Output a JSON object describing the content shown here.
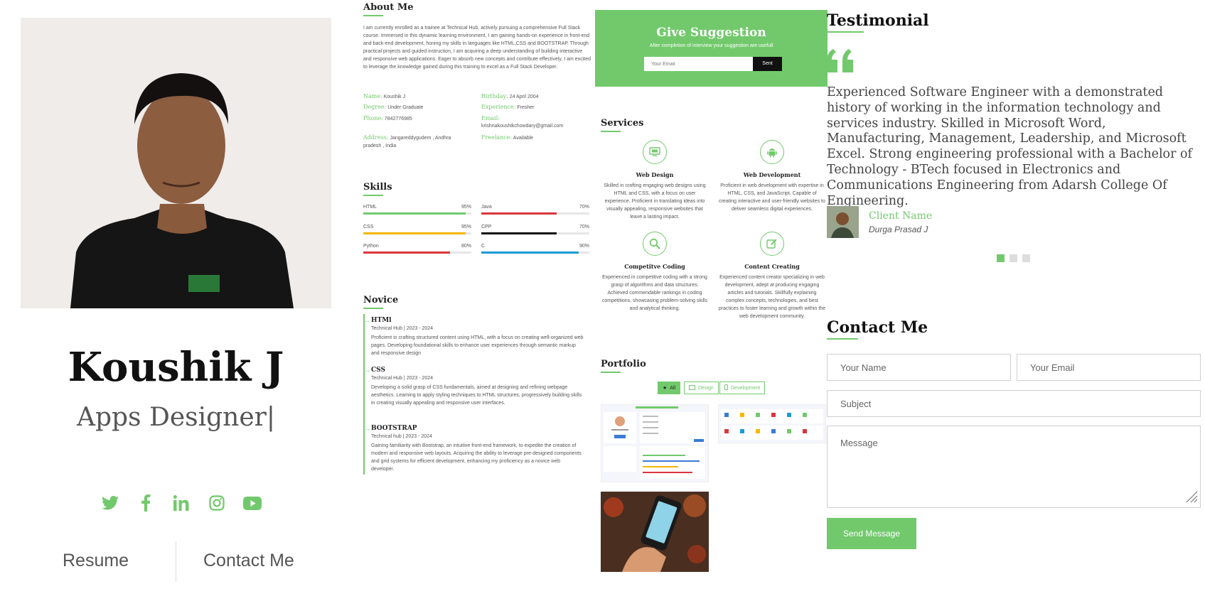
{
  "profile": {
    "name": "Koushik J",
    "role": "Apps Designer|",
    "socials": [
      "twitter-icon",
      "facebook-icon",
      "linkedin-icon",
      "instagram-icon",
      "youtube-icon"
    ],
    "links": {
      "resume": "Resume",
      "contact": "Contact Me"
    }
  },
  "about": {
    "title": "About Me",
    "text": "I am currently enrolled as a trainee at Technical Hub, actively pursuing a comprehensive Full Stack course. Immersed in this dynamic learning environment, I am gaining hands-on experience in front-end and back-end development, honing my skills in languages like HTML,CSS and BOOTSTRAP. Through practical projects and guided instruction, I am acquiring a deep understanding of building interactive and responsive web applications. Eager to absorb new concepts and contribute effectively, I am excited to leverage the knowledge gained during this training to excel as a Full Stack Developer.",
    "fields": {
      "name_label": "Name:",
      "name_value": "Koushik J",
      "birthday_label": "Birthday:",
      "birthday_value": "24 April 2004",
      "degree_label": "Degree:",
      "degree_value": "Under Graduate",
      "experience_label": "Experience:",
      "experience_value": "Fresher",
      "phone_label": "Phone:",
      "phone_value": "7842776985",
      "email_label": "Email:",
      "email_value": "krishnakoushikchowdary@gmail.com",
      "address_label": "Address:",
      "address_value": "Jangareddygudem , Andhra pradesh , India",
      "freelance_label": "Freelance:",
      "freelance_value": "Available"
    }
  },
  "skills": {
    "title": "Skills",
    "items": [
      {
        "name": "HTML",
        "percent": "95%",
        "value": 95,
        "color": "#72c96c"
      },
      {
        "name": "Java",
        "percent": "70%",
        "value": 70,
        "color": "#d9363e"
      },
      {
        "name": "CSS",
        "percent": "95%",
        "value": 95,
        "color": "#f5b700"
      },
      {
        "name": "CPP",
        "percent": "70%",
        "value": 70,
        "color": "#111111"
      },
      {
        "name": "Python",
        "percent": "80%",
        "value": 80,
        "color": "#d9363e"
      },
      {
        "name": "C",
        "percent": "90%",
        "value": 90,
        "color": "#1c9ad6"
      }
    ]
  },
  "novice": {
    "title": "Novice",
    "items": [
      {
        "title": "HTMl",
        "org": "Technical Hub",
        "years": "2023 - 2024",
        "desc": "Proficient in crafting structured content using HTML, with a focus on creating well-organized web pages. Developing foundational skills to enhance user experiences through semantic markup and responsive design"
      },
      {
        "title": "CSS",
        "org": "Technical Hub",
        "years": "2023 - 2024",
        "desc": "Developing a solid grasp of CSS fundamentals, aimed at designing and refining webpage aesthetics. Learning to apply styling techniques to HTML structures, progressively building skills in creating visually appealing and responsive user interfaces."
      },
      {
        "title": "BOOTSTRAP",
        "org": "Technical hub",
        "years": "2023 - 2024",
        "desc": "Gaining familiarity with Bootstrap, an intuitive front-end framework, to expedite the creation of modern and responsive web layouts. Acquiring the ability to leverage pre-designed components and grid systems for efficient development, enhancing my proficiency as a novice web developer."
      }
    ]
  },
  "suggestion": {
    "title": "Give Suggestion",
    "subtitle": "After completion of interview your suggestion are usefull",
    "placeholder": "Your Email",
    "button": "Sent"
  },
  "services": {
    "title": "Services",
    "items": [
      {
        "title": "Web Design",
        "icon": "monitor-icon",
        "desc": "Skilled in crafting engaging web designs using HTML and CSS, with a focus on user experience. Proficient in translating ideas into visually appealing, responsive websites that leave a lasting impact."
      },
      {
        "title": "Web Development",
        "icon": "android-icon",
        "desc": "Proficient in web development with expertise in HTML, CSS, and JavaScript. Capable of creating interactive and user-friendly websites to deliver seamless digital experiences."
      },
      {
        "title": "Competitve Coding",
        "icon": "search-icon",
        "desc": "Experienced in competitive coding with a strong grasp of algorithms and data structures. Achieved commendable rankings in coding competitions, showcasing problem-solving skills and analytical thinking."
      },
      {
        "title": "Content Creating",
        "icon": "edit-icon",
        "desc": "Experienced content creator specializing in web development, adept at producing engaging articles and tutorials. Skillfully explaining complex concepts, technologies, and best practices to foster learning and growth within the web development community."
      }
    ]
  },
  "portfolio": {
    "title": "Portfolio",
    "filters": [
      "All",
      "Design",
      "Development"
    ]
  },
  "testimonial": {
    "title": "Testimonial",
    "quote": "Experienced Software Engineer with a demonstrated history of working in the information technology and services industry. Skilled in Microsoft Word, Manufacturing, Management, Leadership, and Microsoft Excel. Strong engineering professional with a Bachelor of Technology - BTech focused in Electronics and Communications Engineering from Adarsh College Of Engineering.",
    "client_name": "Client Name",
    "client_sub": "Durga Prasad J"
  },
  "contact": {
    "title": "Contact Me",
    "name_placeholder": "Your Name",
    "email_placeholder": "Your Email",
    "subject_placeholder": "Subject",
    "message_placeholder": "Message",
    "button": "Send Message"
  },
  "colors": {
    "accent": "#72c96c"
  }
}
